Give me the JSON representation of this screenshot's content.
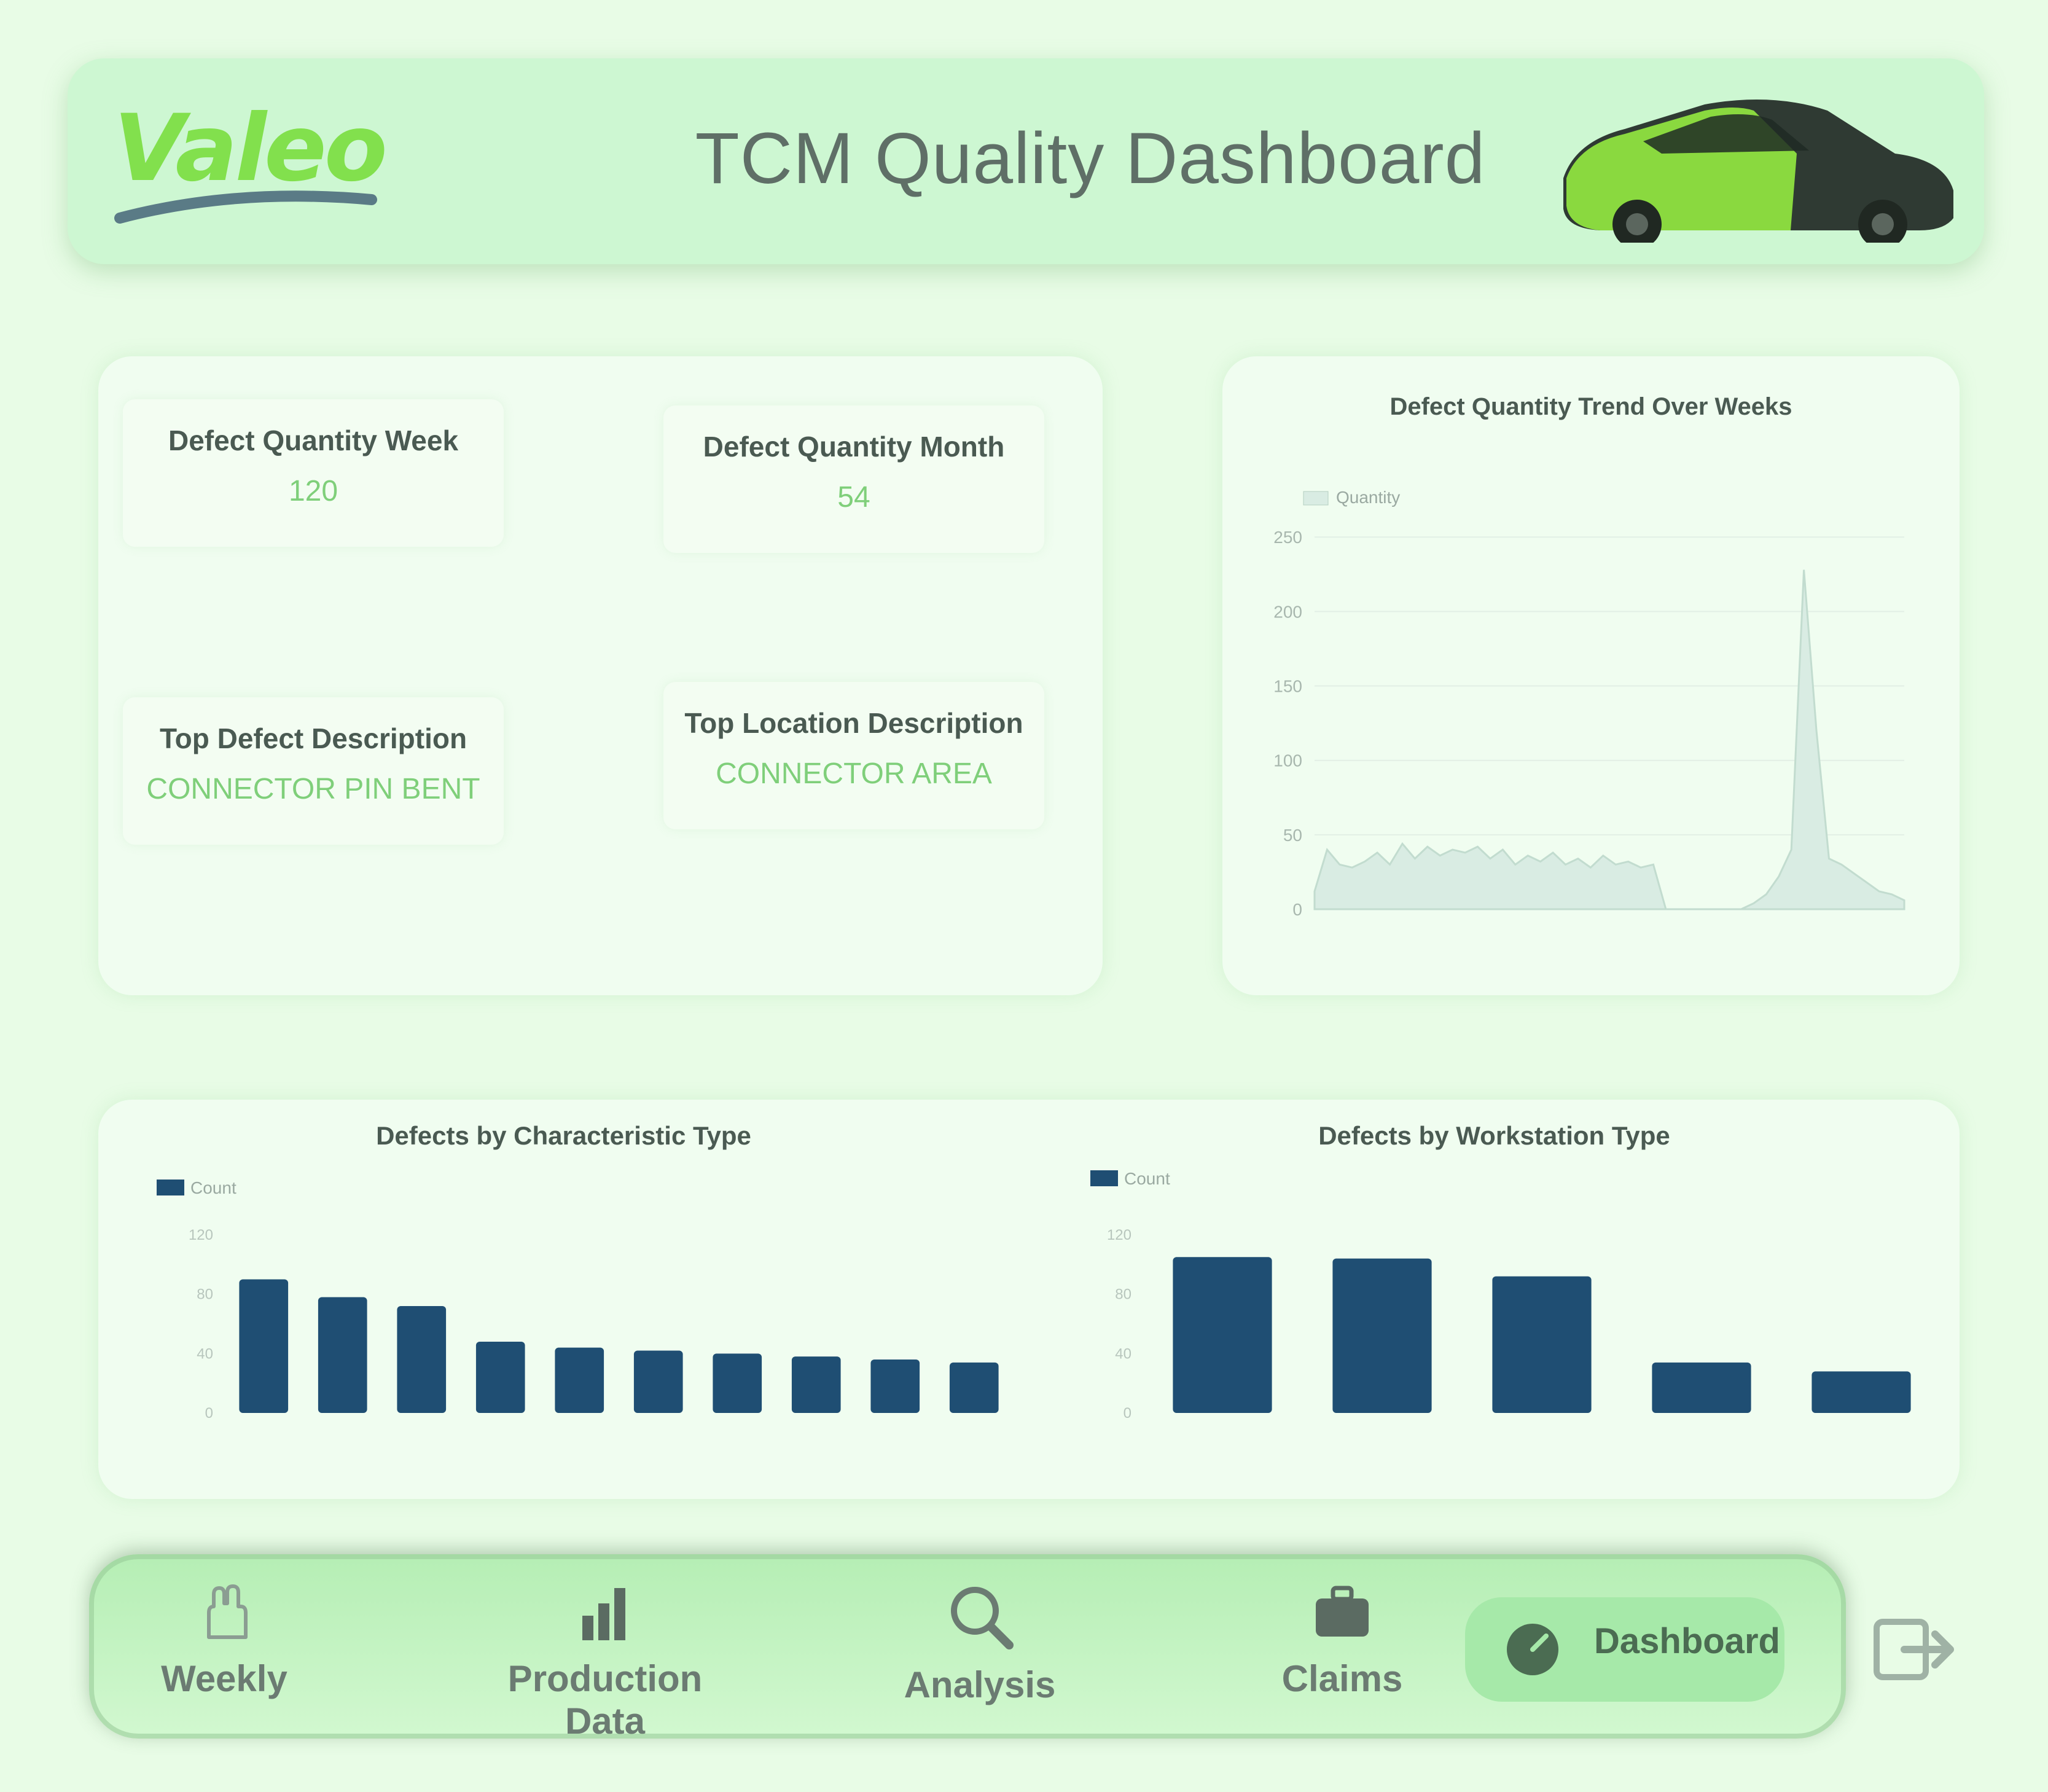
{
  "header": {
    "brand": "Valeo",
    "title": "TCM Quality Dashboard",
    "icons": [
      "valeo-logo-icon",
      "car-icon"
    ]
  },
  "kpis": [
    {
      "label": "Defect Quantity Week",
      "value": "120"
    },
    {
      "label": "Defect Quantity Month",
      "value": "54"
    },
    {
      "label": "Top Defect Description",
      "value": "CONNECTOR PIN BENT"
    },
    {
      "label": "Top Location Description",
      "value": "CONNECTOR AREA"
    }
  ],
  "trend": {
    "title": "Defect Quantity Trend Over Weeks",
    "legend": "Quantity",
    "chart_data": {
      "type": "area",
      "x": [
        1,
        2,
        3,
        4,
        5,
        6,
        7,
        8,
        9,
        10,
        11,
        12,
        13,
        14,
        15,
        16,
        17,
        18,
        19,
        20,
        21,
        22,
        23,
        24,
        25,
        26,
        27,
        28,
        29,
        30,
        31,
        32,
        33,
        34,
        35,
        36,
        37,
        38,
        39,
        40,
        41,
        42,
        43,
        44,
        45,
        46,
        47,
        48
      ],
      "y": [
        12,
        40,
        30,
        28,
        32,
        38,
        30,
        44,
        34,
        42,
        36,
        40,
        38,
        42,
        34,
        40,
        30,
        36,
        32,
        38,
        30,
        34,
        28,
        36,
        30,
        32,
        28,
        30,
        0,
        0,
        0,
        0,
        0,
        0,
        0,
        4,
        10,
        22,
        40,
        228,
        120,
        34,
        30,
        24,
        18,
        12,
        10,
        6
      ],
      "yticks": [
        0,
        50,
        100,
        150,
        200,
        250
      ],
      "ylim": [
        0,
        260
      ],
      "grid": true,
      "legend_position": "top-left",
      "color": "#d9ece3"
    }
  },
  "bar_left": {
    "title": "Defects by Characteristic Type",
    "legend": "Count",
    "chart_data": {
      "type": "bar",
      "values": [
        90,
        78,
        72,
        48,
        44,
        42,
        40,
        38,
        36,
        34
      ],
      "ylim": [
        0,
        120
      ],
      "yticks": [
        0,
        40,
        80,
        120
      ],
      "color": "#1f4e73"
    }
  },
  "bar_right": {
    "title": "Defects by Workstation Type",
    "legend": "Count",
    "chart_data": {
      "type": "bar",
      "values": [
        105,
        104,
        92,
        34,
        28
      ],
      "ylim": [
        0,
        120
      ],
      "yticks": [
        0,
        40,
        80,
        120
      ],
      "color": "#1f4e73"
    }
  },
  "nav": {
    "items": [
      {
        "label": "Weekly",
        "icon": "hand-icon"
      },
      {
        "label": "Production Data",
        "icon": "bar-chart-icon"
      },
      {
        "label": "Analysis",
        "icon": "magnifier-icon"
      },
      {
        "label": "Claims",
        "icon": "briefcase-icon"
      },
      {
        "label": "Dashboard",
        "icon": "dashboard-icon"
      }
    ],
    "active_index": 4,
    "exit_icon": "exit-icon"
  }
}
